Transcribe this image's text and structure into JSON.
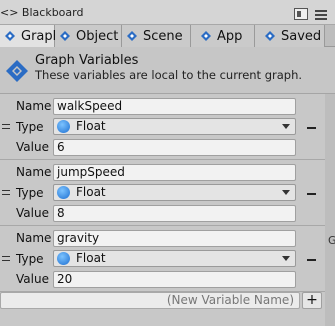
{
  "window": {
    "title": "<> Blackboard",
    "icons": [
      "layout-icon",
      "menu-icon"
    ]
  },
  "tabs": [
    {
      "label": "Graph",
      "icon": "graph-icon",
      "active": true
    },
    {
      "label": "Object",
      "icon": "object-icon",
      "active": false
    },
    {
      "label": "Scene",
      "icon": "scene-icon",
      "active": false
    },
    {
      "label": "App",
      "icon": "app-icon",
      "active": false
    },
    {
      "label": "Saved",
      "icon": "saved-icon",
      "active": false
    }
  ],
  "header": {
    "title": "Graph Variables",
    "subtitle": "These variables are local to the current graph.",
    "icon": "variables-icon"
  },
  "labels": {
    "name": "Name",
    "type": "Type",
    "value": "Value"
  },
  "variables": [
    {
      "name": "walkSpeed",
      "type": "Float",
      "value": "6"
    },
    {
      "name": "jumpSpeed",
      "type": "Float",
      "value": "8"
    },
    {
      "name": "gravity",
      "type": "Float",
      "value": "20"
    }
  ],
  "new_variable": {
    "placeholder": "(New Variable Name)",
    "add_label": "+"
  },
  "side_edge_text": "G",
  "colors": {
    "type_icon": "#1d6fd1",
    "active_tab": "#e2e2e2"
  }
}
